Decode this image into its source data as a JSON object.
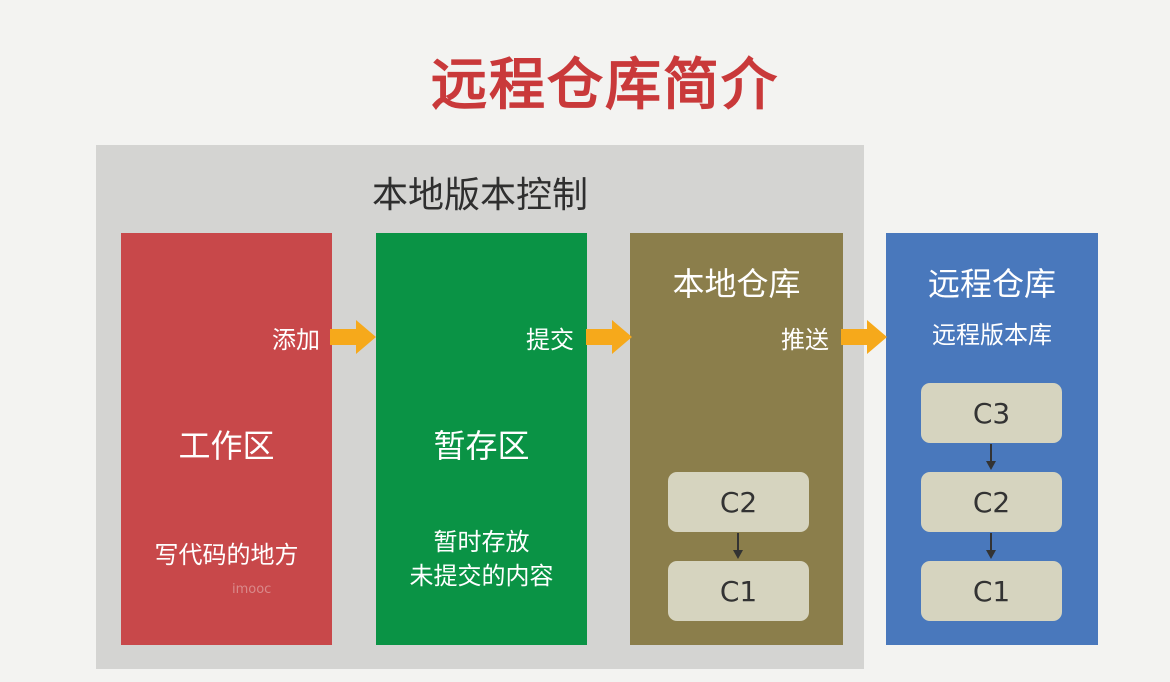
{
  "title": "远程仓库简介",
  "local_control": {
    "title": "本地版本控制"
  },
  "workspace": {
    "name": "工作区",
    "description": "写代码的地方",
    "watermark": "imooc"
  },
  "staging": {
    "name": "暂存区",
    "description_line1": "暂时存放",
    "description_line2": "未提交的内容"
  },
  "local_repo": {
    "name": "本地仓库",
    "commits": [
      "C2",
      "C1"
    ]
  },
  "remote_repo": {
    "name": "远程仓库",
    "subtitle": "远程版本库",
    "commits": [
      "C3",
      "C2",
      "C1"
    ]
  },
  "actions": {
    "add": "添加",
    "commit": "提交",
    "push": "推送"
  },
  "colors": {
    "title": "#c9393a",
    "workspace": "#c8484a",
    "staging": "#0a9345",
    "local_repo": "#8b7e4b",
    "remote_repo": "#4978bc",
    "arrow": "#f6a91b",
    "commit_box": "#d6d4bf"
  }
}
